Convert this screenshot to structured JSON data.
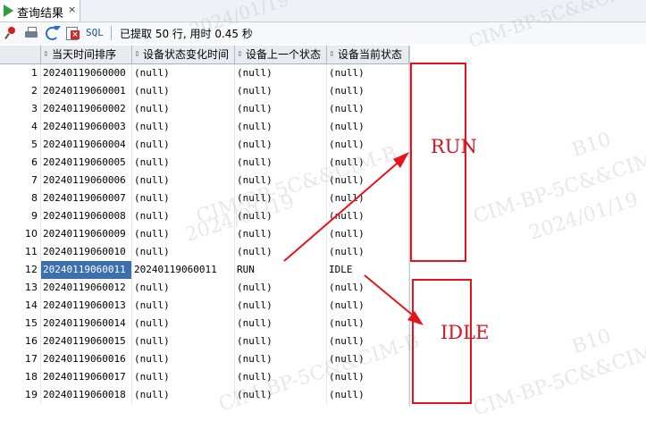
{
  "tab": {
    "label": "查询结果",
    "close": "×",
    "icon": "run-triangle-icon"
  },
  "toolbar": {
    "icons": [
      "pin-icon",
      "print-icon",
      "refresh-icon",
      "delete-icon"
    ],
    "sql_label": "SQL",
    "status": "已提取 50 行, 用时 0.45 秒"
  },
  "columns": [
    "当天时间排序",
    "设备状态变化时间",
    "设备上一个状态",
    "设备当前状态"
  ],
  "rows": [
    {
      "n": "1",
      "c1": "20240119060000",
      "c2": "(null)",
      "c3": "(null)",
      "c4": "(null)"
    },
    {
      "n": "2",
      "c1": "20240119060001",
      "c2": "(null)",
      "c3": "(null)",
      "c4": "(null)"
    },
    {
      "n": "3",
      "c1": "20240119060002",
      "c2": "(null)",
      "c3": "(null)",
      "c4": "(null)"
    },
    {
      "n": "4",
      "c1": "20240119060003",
      "c2": "(null)",
      "c3": "(null)",
      "c4": "(null)"
    },
    {
      "n": "5",
      "c1": "20240119060004",
      "c2": "(null)",
      "c3": "(null)",
      "c4": "(null)"
    },
    {
      "n": "6",
      "c1": "20240119060005",
      "c2": "(null)",
      "c3": "(null)",
      "c4": "(null)"
    },
    {
      "n": "7",
      "c1": "20240119060006",
      "c2": "(null)",
      "c3": "(null)",
      "c4": "(null)"
    },
    {
      "n": "8",
      "c1": "20240119060007",
      "c2": "(null)",
      "c3": "(null)",
      "c4": "(null)"
    },
    {
      "n": "9",
      "c1": "20240119060008",
      "c2": "(null)",
      "c3": "(null)",
      "c4": "(null)"
    },
    {
      "n": "10",
      "c1": "20240119060009",
      "c2": "(null)",
      "c3": "(null)",
      "c4": "(null)"
    },
    {
      "n": "11",
      "c1": "20240119060010",
      "c2": "(null)",
      "c3": "(null)",
      "c4": "(null)"
    },
    {
      "n": "12",
      "c1": "20240119060011",
      "c2": "20240119060011",
      "c3": "RUN",
      "c4": "IDLE"
    },
    {
      "n": "13",
      "c1": "20240119060012",
      "c2": "(null)",
      "c3": "(null)",
      "c4": "(null)"
    },
    {
      "n": "14",
      "c1": "20240119060013",
      "c2": "(null)",
      "c3": "(null)",
      "c4": "(null)"
    },
    {
      "n": "15",
      "c1": "20240119060014",
      "c2": "(null)",
      "c3": "(null)",
      "c4": "(null)"
    },
    {
      "n": "16",
      "c1": "20240119060015",
      "c2": "(null)",
      "c3": "(null)",
      "c4": "(null)"
    },
    {
      "n": "17",
      "c1": "20240119060016",
      "c2": "(null)",
      "c3": "(null)",
      "c4": "(null)"
    },
    {
      "n": "18",
      "c1": "20240119060017",
      "c2": "(null)",
      "c3": "(null)",
      "c4": "(null)"
    },
    {
      "n": "19",
      "c1": "20240119060018",
      "c2": "(null)",
      "c3": "(null)",
      "c4": "(null)"
    }
  ],
  "selected_row": 12,
  "annotations": {
    "run_label": "RUN",
    "idle_label": "IDLE",
    "color": "#e8121c"
  },
  "watermark": {
    "line1": "B10",
    "line2": "CIM-BP-5C&&CIM-B",
    "line3": "2024/01/19"
  }
}
